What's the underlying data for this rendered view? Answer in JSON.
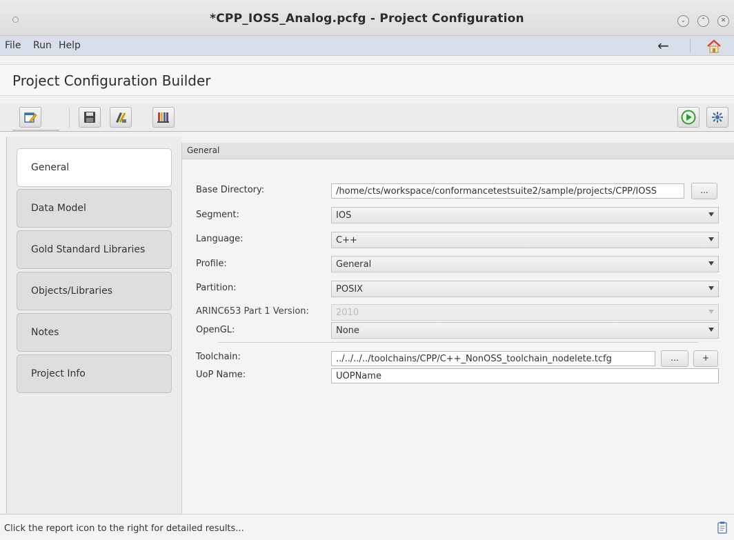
{
  "window": {
    "title": "*CPP_IOSS_Analog.pcfg - Project Configuration",
    "controls": [
      "minimize-icon",
      "maximize-icon",
      "close-icon"
    ]
  },
  "menu": {
    "items": [
      "File",
      "Run",
      "Help"
    ],
    "back_icon": "back-arrow-icon",
    "home_icon": "home-icon"
  },
  "header": {
    "title": "Project Configuration Builder"
  },
  "toolbar": {
    "left_icons": [
      "edit-icon",
      "save-icon",
      "tool-icon",
      "book-icon"
    ],
    "right_icons": [
      "run-icon",
      "settings-icon"
    ]
  },
  "tabs": [
    {
      "label": "General",
      "active": true
    },
    {
      "label": "Data Model",
      "active": false
    },
    {
      "label": "Gold Standard Libraries",
      "active": false
    },
    {
      "label": "Objects/Libraries",
      "active": false
    },
    {
      "label": "Notes",
      "active": false
    },
    {
      "label": "Project Info",
      "active": false
    }
  ],
  "section": {
    "title": "General"
  },
  "form": {
    "base_directory": {
      "label": "Base Directory:",
      "value": "/home/cts/workspace/conformancetestsuite2/sample/projects/CPP/IOSS",
      "browse": "..."
    },
    "segment": {
      "label": "Segment:",
      "value": "IOS"
    },
    "language": {
      "label": "Language:",
      "value": "C++"
    },
    "profile": {
      "label": "Profile:",
      "value": "General"
    },
    "partition": {
      "label": "Partition:",
      "value": "POSIX"
    },
    "arinc": {
      "label": "ARINC653 Part 1 Version:",
      "value": "2010",
      "disabled": true
    },
    "opengl": {
      "label": "OpenGL:",
      "value": "None"
    },
    "toolchain": {
      "label": "Toolchain:",
      "value": "../../../../toolchains/CPP/C++_NonOSS_toolchain_nodelete.tcfg",
      "browse": "...",
      "add": "+"
    },
    "uop_name": {
      "label": "UoP Name:",
      "value": "UOPName"
    }
  },
  "status": {
    "text": "Click the report icon to the right for detailed results...",
    "icon": "report-icon"
  },
  "colors": {
    "menubar": "#d8dfe8",
    "run_green": "#2e9e2e",
    "home_roof": "#d9472b"
  }
}
